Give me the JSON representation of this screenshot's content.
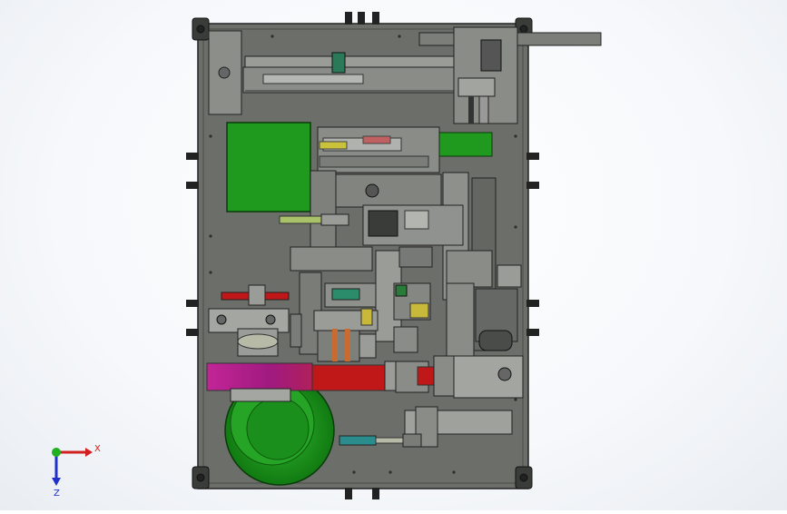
{
  "viewport": {
    "background": "#f4f6f9",
    "plate_color": "#6e706c",
    "green_part_color": "#1f9a1f",
    "magenta_part_color": "#b21d8c",
    "red_part_color": "#c01818",
    "cyan_part_color": "#2a8c8c"
  },
  "triad": {
    "x_label": "X",
    "z_label": "Z",
    "x_color": "#d22020",
    "y_color": "#20b020",
    "z_color": "#2030c8"
  }
}
